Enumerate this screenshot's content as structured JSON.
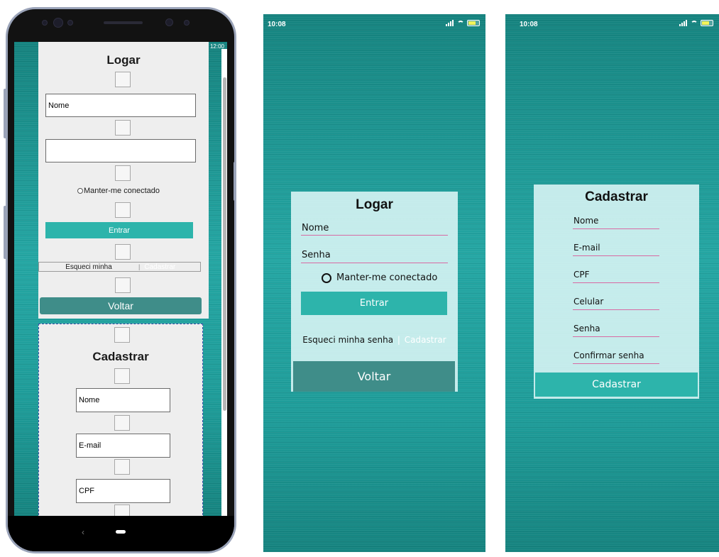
{
  "phone_mockup": {
    "status_time": "12:00",
    "login": {
      "title": "Logar",
      "name_value": "Nome",
      "password_value": "",
      "keep_connected": "Manter-me conectado",
      "enter_button": "Entrar",
      "forgot": "Esqueci minha",
      "register_link": "Cadastrar",
      "back_button": "Voltar"
    },
    "register": {
      "title": "Cadastrar",
      "fields": [
        "Nome",
        "E-mail",
        "CPF"
      ]
    },
    "nav_back_glyph": "‹"
  },
  "login_screen": {
    "status_time": "10:08",
    "title": "Logar",
    "name_label": "Nome",
    "password_label": "Senha",
    "keep_connected": "Manter-me conectado",
    "enter_button": "Entrar",
    "forgot_password": "Esqueci minha senha",
    "separator": "|",
    "register_link": "Cadastrar",
    "back_button": "Voltar"
  },
  "register_screen": {
    "status_time": "10:08",
    "title": "Cadastrar",
    "fields": [
      "Nome",
      "E-mail",
      "CPF",
      "Celular",
      "Senha",
      "Confirmar senha"
    ],
    "submit_button": "Cadastrar"
  },
  "colors": {
    "teal_button": "#2db4ab",
    "dark_teal_button": "#3f8d89",
    "field_underline": "#d86aa3",
    "background_teal": "#1f9a98"
  }
}
